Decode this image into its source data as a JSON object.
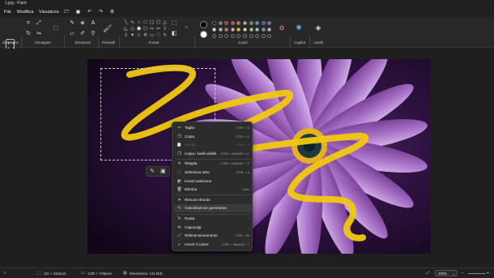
{
  "window": {
    "title": "1.jpg - Paint"
  },
  "menu": {
    "file": "File",
    "edit": "Modifica",
    "view": "Visualizza"
  },
  "ribbon": {
    "groups": {
      "selection": "Selezione",
      "image": "Immagine",
      "tools": "Strumenti",
      "brushes": "Pennelli",
      "shapes": "Forme",
      "colors": "Colori",
      "copilot": "Copilot",
      "layers": "Livelli"
    },
    "palette_row1": [
      "#000000",
      "#7f7f7f",
      "#c3272b",
      "#e8344a",
      "#f06a2b",
      "#f5c518",
      "#2fb05a",
      "#3aa0e8",
      "#3b4fc4",
      "#a14bc0"
    ],
    "palette_row2": [
      "#ffffff",
      "#c3c3c3",
      "#b97a57",
      "#ffaec9",
      "#ffc90e",
      "#efe4b0",
      "#b5e61d",
      "#99d9ea",
      "#7092be",
      "#c8bfe7"
    ],
    "primary_color": "#000000",
    "secondary_color": "#ffffff"
  },
  "context_menu": {
    "items": [
      {
        "icon": "cut-icon",
        "glyph": "✂",
        "label": "Taglia",
        "shortcut": "CTRL + X",
        "enabled": true
      },
      {
        "icon": "copy-icon",
        "glyph": "❐",
        "label": "Copia",
        "shortcut": "CTRL + C",
        "enabled": true
      },
      {
        "icon": "paste-icon",
        "glyph": "📋",
        "label": "Incolla",
        "shortcut": "CTRL + V",
        "enabled": false
      },
      {
        "icon": "copy-visible-layers-icon",
        "glyph": "❐",
        "label": "Copia i livelli visibili",
        "shortcut": "CTRL + MAIUSC + C",
        "enabled": true
      },
      {
        "icon": "crop-icon",
        "glyph": "⌗",
        "label": "Ritaglia",
        "shortcut": "CTRL + MAIUSC + X",
        "enabled": true
      },
      {
        "icon": "select-all-icon",
        "glyph": "⬚",
        "label": "Seleziona tutto",
        "shortcut": "CTRL + A",
        "enabled": true
      },
      {
        "icon": "invert-selection-icon",
        "glyph": "◩",
        "label": "Inverti selezione",
        "shortcut": "",
        "enabled": true
      },
      {
        "icon": "delete-icon",
        "glyph": "🗑",
        "label": "Elimina",
        "shortcut": "Canc",
        "enabled": true
      },
      {
        "icon": "remove-background-icon",
        "glyph": "✦",
        "label": "Rimuovi sfondo",
        "shortcut": "",
        "enabled": true
      },
      {
        "icon": "generative-erase-icon",
        "glyph": "✎",
        "label": "Cancellazione generativa",
        "shortcut": "",
        "enabled": true
      },
      {
        "icon": "rotate-icon",
        "glyph": "↻",
        "label": "Ruota",
        "shortcut": "›",
        "enabled": true
      },
      {
        "icon": "flip-icon",
        "glyph": "⇋",
        "label": "Capovolgi",
        "shortcut": "›",
        "enabled": true
      },
      {
        "icon": "resize-icon",
        "glyph": "⤢",
        "label": "Ridimensionamento",
        "shortcut": "CTRL + W",
        "enabled": true
      },
      {
        "icon": "invert-colors-icon",
        "glyph": "◐",
        "label": "Inverti il colore",
        "shortcut": "CTRL + MAIUSC + I",
        "enabled": true
      }
    ]
  },
  "status": {
    "selection_size": "421 × 342pixel",
    "image_size": "1280 × 720pixel",
    "file_size": "Dimensione: 144,5KB",
    "zoom": "100%"
  }
}
